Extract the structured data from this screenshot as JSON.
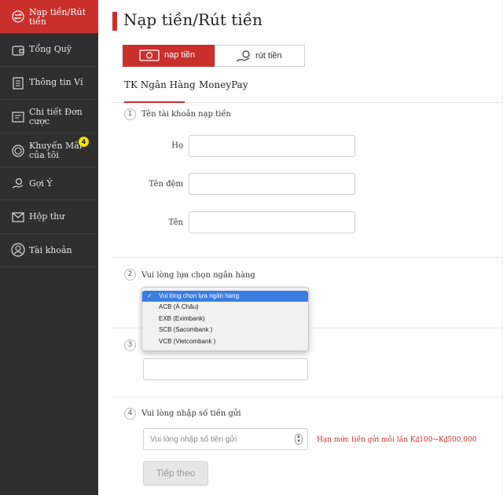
{
  "sidebar": {
    "items": [
      {
        "label": "Nạp tiền/Rút tiền",
        "icon": "exchange-icon",
        "active": true
      },
      {
        "label": "Tổng Quỹ",
        "icon": "wallet-icon"
      },
      {
        "label": "Thông tin Ví",
        "icon": "document-icon"
      },
      {
        "label": "Chi tiết Đơn cược",
        "icon": "receipt-icon"
      },
      {
        "label": "Khuyến Mãi của tôi",
        "icon": "coin-icon",
        "badge": "4"
      },
      {
        "label": "Gợi Ý",
        "icon": "hand-coin-icon"
      },
      {
        "label": "Hộp thư",
        "icon": "mail-icon"
      },
      {
        "label": "Tài khoản",
        "icon": "user-icon"
      }
    ]
  },
  "main": {
    "title": "Nạp tiền/Rút tiền",
    "op_tabs": [
      {
        "label": "nạp tiền",
        "active": true
      },
      {
        "label": "rút tiền",
        "active": false
      }
    ],
    "sub_tabs": [
      {
        "label": "TK Ngân Hàng",
        "active": true
      },
      {
        "label": "MoneyPay",
        "active": false
      }
    ],
    "steps": [
      {
        "num": "1",
        "title": "Tên tài khoản nạp tiền"
      },
      {
        "num": "2",
        "title": "Vui lòng lựa chọn ngân hàng"
      },
      {
        "num": "3",
        "title": ""
      },
      {
        "num": "4",
        "title": "Vui lòng nhập số tiền gửi"
      }
    ],
    "name_fields": [
      {
        "label": "Họ",
        "value": ""
      },
      {
        "label": "Tên đệm",
        "value": ""
      },
      {
        "label": "Tên",
        "value": ""
      }
    ],
    "bank_dropdown": {
      "selected": "Vui lòng chọn lựa ngân hàng",
      "options": [
        "Vui lòng chọn lựa ngân hàng",
        "ACB (Á Châu)",
        "EXB (Eximbank)",
        "SCB (Sacombank )",
        "VCB (Vietcombank )"
      ]
    },
    "amount": {
      "placeholder": "Vui lòng nhập số tiền gửi",
      "value": ""
    },
    "limit_text": "Hạn mức tiền gửi mỗi lần K₫100~K₫500,000",
    "submit_label": "Tiếp theo"
  },
  "colors": {
    "accent": "#c9302c",
    "sidebar_bg": "#2f2f2f",
    "selected_option": "#3b7de0",
    "badge": "#f4e300"
  }
}
